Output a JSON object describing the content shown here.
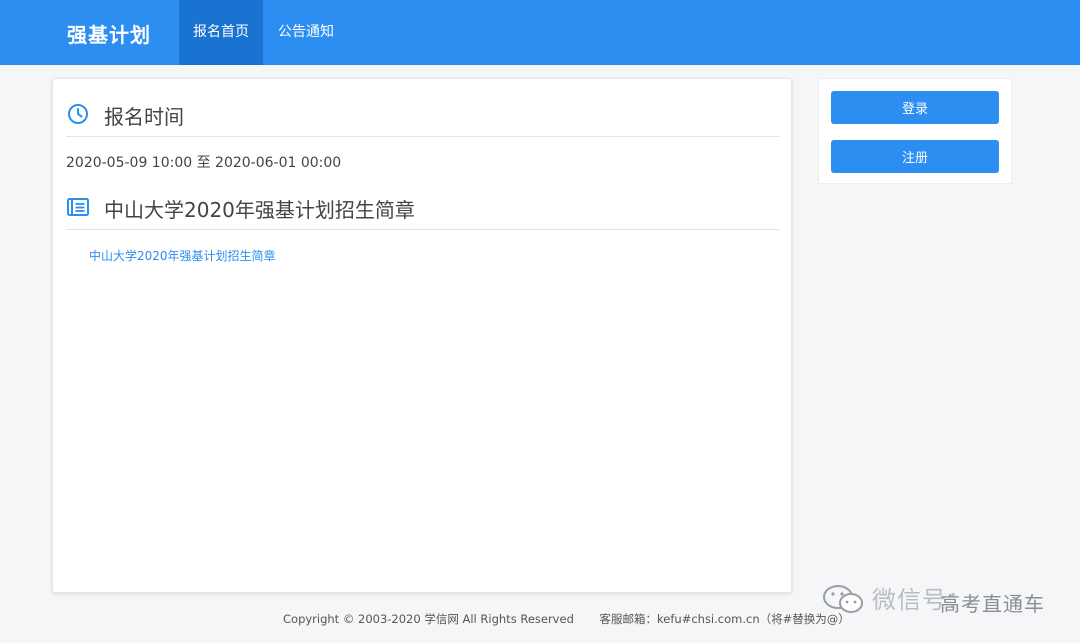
{
  "header": {
    "brand": "强基计划",
    "nav": [
      {
        "label": "报名首页",
        "active": true
      },
      {
        "label": "公告通知",
        "active": false
      }
    ],
    "bg_color": "#2b8ef0",
    "active_color": "#1a73d1"
  },
  "main": {
    "registration": {
      "icon": "clock-icon",
      "title": "报名时间",
      "time_range": "2020-05-09 10:00 至 2020-06-01 00:00"
    },
    "brochure": {
      "icon": "newspaper-icon",
      "title": "中山大学2020年强基计划招生简章",
      "link_text": "中山大学2020年强基计划招生简章"
    }
  },
  "sidebar": {
    "login_label": "登录",
    "register_label": "注册"
  },
  "footer": {
    "copyright": "Copyright © 2003-2020 学信网 All Rights Reserved",
    "email": "客服邮箱：kefu#chsi.com.cn（将#替换为@）"
  },
  "watermark": {
    "icon": "wechat-icon",
    "text": "微信号：",
    "text2": "高考直通车"
  }
}
